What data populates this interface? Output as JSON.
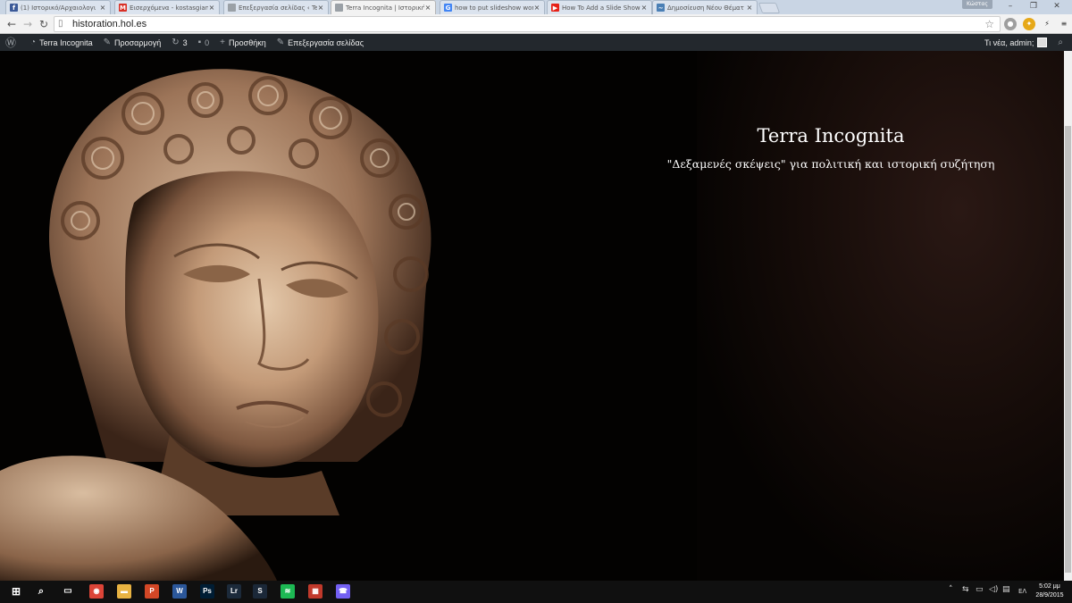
{
  "browser": {
    "tabs": [
      {
        "title": "(1) Ιστορικό/Αρχαιολογι",
        "icon": "facebook-icon",
        "color": "#3b5998",
        "glyph": "f"
      },
      {
        "title": "Εισερχόμενα - kostasgian",
        "icon": "gmail-icon",
        "color": "#d93025",
        "glyph": "M"
      },
      {
        "title": "Επεξεργασία σελίδας ‹ Ter",
        "icon": "page-icon",
        "color": "#9aa0a6",
        "glyph": ""
      },
      {
        "title": "Terra Incognita | Ιστορική",
        "icon": "page-icon",
        "color": "#9aa0a6",
        "glyph": "",
        "active": true
      },
      {
        "title": "how to put slideshow wor",
        "icon": "google-icon",
        "color": "#4285f4",
        "glyph": "G"
      },
      {
        "title": "How To Add a Slide Show",
        "icon": "youtube-icon",
        "color": "#e62117",
        "glyph": "▶"
      },
      {
        "title": "Δημοσίευση Νέου Θέματ",
        "icon": "forum-icon",
        "color": "#4a7fb5",
        "glyph": "~"
      }
    ],
    "close_glyph": "×",
    "profile_name": "Κώστας",
    "url": "historation.hol.es"
  },
  "adminbar": {
    "site_name": "Terra Incognita",
    "customize": "Προσαρμογή",
    "updates_count": "3",
    "comments_count": "0",
    "add_new": "Προσθήκη",
    "edit_page": "Επεξεργασία σελίδας",
    "greeting": "Τι νέα, admin;"
  },
  "hero": {
    "title": "Terra Incognita",
    "tagline": "\"Δεξαμενές σκέψεις\" για πολιτική και ιστορική συζήτηση"
  },
  "taskbar": {
    "apps": [
      {
        "name": "chrome-icon",
        "color": "#db4437",
        "glyph": "◉"
      },
      {
        "name": "file-explorer-icon",
        "color": "#e8b342",
        "glyph": "▬"
      },
      {
        "name": "powerpoint-icon",
        "color": "#d24726",
        "glyph": "P"
      },
      {
        "name": "word-icon",
        "color": "#2b579a",
        "glyph": "W"
      },
      {
        "name": "photoshop-icon",
        "color": "#001d34",
        "glyph": "Ps"
      },
      {
        "name": "lightroom-icon",
        "color": "#1c2a3a",
        "glyph": "Lr"
      },
      {
        "name": "steam-icon",
        "color": "#1b2838",
        "glyph": "S"
      },
      {
        "name": "spotify-icon",
        "color": "#1db954",
        "glyph": "≋"
      },
      {
        "name": "paint-icon",
        "color": "#c0392b",
        "glyph": "▦"
      },
      {
        "name": "viber-icon",
        "color": "#7360f2",
        "glyph": "☎"
      }
    ],
    "language": "ΕΛ",
    "time": "5:02 μμ",
    "date": "28/9/2015"
  }
}
